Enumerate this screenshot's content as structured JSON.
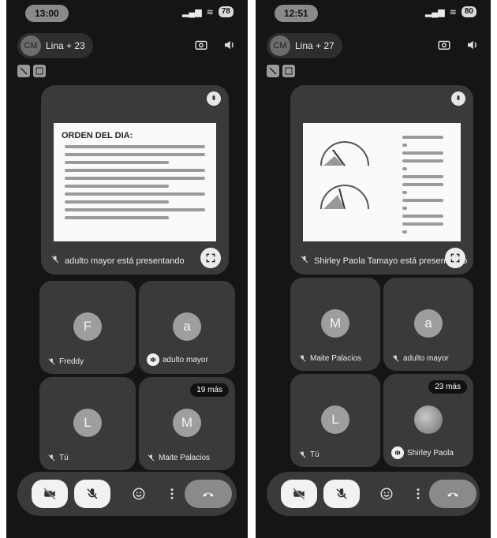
{
  "phones": [
    {
      "status_time": "13:00",
      "battery": "78",
      "meeting_title": "Lina + 23",
      "avatar_initials": "CM",
      "presentation": {
        "doc_title": "ORDEN DEL DIA:",
        "presenter_label": "adulto mayor está presentando"
      },
      "tiles": [
        {
          "initial": "F",
          "name": "Freddy",
          "speaking": false
        },
        {
          "initial": "a",
          "name": "adulto mayor",
          "speaking": true
        },
        {
          "initial": "L",
          "name": "Tú",
          "speaking": false
        },
        {
          "initial": "M",
          "name": "Maite Palacios",
          "speaking": false,
          "badge": "19 más"
        }
      ]
    },
    {
      "status_time": "12:51",
      "battery": "80",
      "meeting_title": "Lina + 27",
      "avatar_initials": "CM",
      "presentation": {
        "doc_title": "",
        "presenter_label": "Shirley Paola Tamayo está presentando"
      },
      "tiles": [
        {
          "initial": "M",
          "name": "Maite Palacios",
          "speaking": false
        },
        {
          "initial": "a",
          "name": "adulto mayor",
          "speaking": false
        },
        {
          "initial": "L",
          "name": "Tú",
          "speaking": false
        },
        {
          "initial": "",
          "name": "Shirley Paola",
          "speaking": true,
          "badge": "23 más",
          "photo": true
        }
      ]
    }
  ],
  "icons": {
    "camera_switch": "camera-switch-icon",
    "speaker": "speaker-icon",
    "camera_off": "camera-off-icon",
    "mic_off": "mic-off-icon",
    "emoji": "emoji-icon",
    "more": "more-vert-icon",
    "end_call": "end-call-icon",
    "fullscreen": "fullscreen-icon"
  }
}
